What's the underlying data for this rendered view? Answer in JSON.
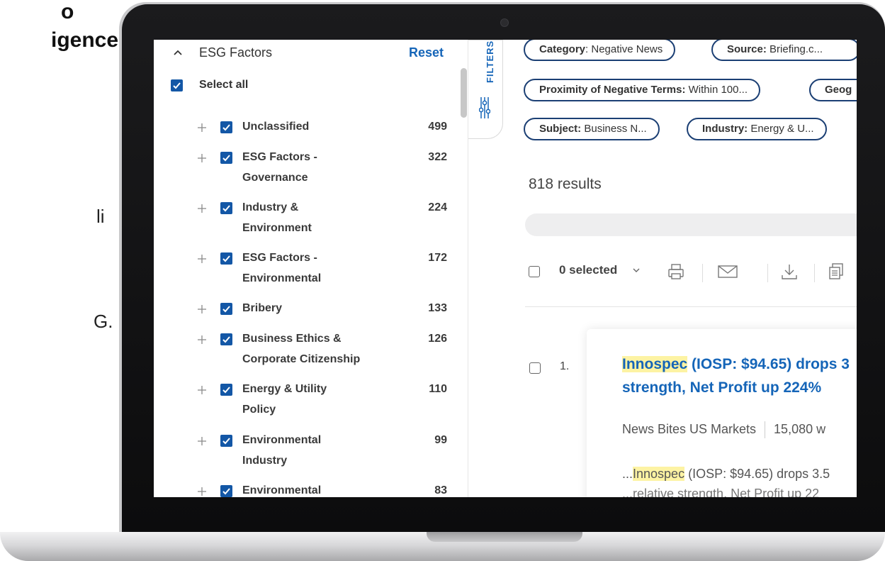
{
  "slide": {
    "title_line1": "o",
    "title_line2": "igence",
    "frag1": "li",
    "frag2": "G."
  },
  "panel": {
    "title": "ESG Factors",
    "reset": "Reset",
    "select_all": "Select all",
    "facets": [
      {
        "label": "Unclassified",
        "count": "499"
      },
      {
        "label": "ESG Factors - Governance",
        "count": "322"
      },
      {
        "label": "Industry & Environment",
        "count": "224"
      },
      {
        "label": "ESG Factors - Environmental",
        "count": "172"
      },
      {
        "label": "Bribery",
        "count": "133"
      },
      {
        "label": "Business Ethics & Corporate Citizenship",
        "count": "126"
      },
      {
        "label": "Energy & Utility Policy",
        "count": "110"
      },
      {
        "label": "Environmental Industry",
        "count": "99"
      },
      {
        "label": "Environmental",
        "count": "83"
      }
    ],
    "filters_tab": "FILTERS"
  },
  "chips": [
    {
      "key": "Category",
      "value": ": Negative News"
    },
    {
      "key": "Source:",
      "value": " Briefing.c..."
    },
    {
      "key": "Proximity of Negative Terms:",
      "value": " Within 100..."
    },
    {
      "key": "Geog",
      "value": ""
    },
    {
      "key": "Subject:",
      "value": " Business N..."
    },
    {
      "key": "Industry:",
      "value": " Energy & U..."
    }
  ],
  "results": {
    "count_label": "818 results",
    "selected_label": "0 selected",
    "items": [
      {
        "number": "1.",
        "title_highlight": "Innospec",
        "title_rest_line1": " (IOSP: $94.65) drops 3",
        "title_line2": "strength, Net Profit up 224%",
        "source": "News Bites US Markets",
        "words": "15,080 w",
        "snippet_prefix": "...",
        "snippet_highlight": "Innospec",
        "snippet_rest": " (IOSP: $94.65) drops 3.5",
        "snippet_line2": "...relative strength, Net Profit up 22"
      }
    ]
  },
  "colors": {
    "accent": "#1565b8",
    "checkbox": "#1357a6",
    "chip_border": "#1b3f74",
    "highlight": "#fdf3a3"
  }
}
